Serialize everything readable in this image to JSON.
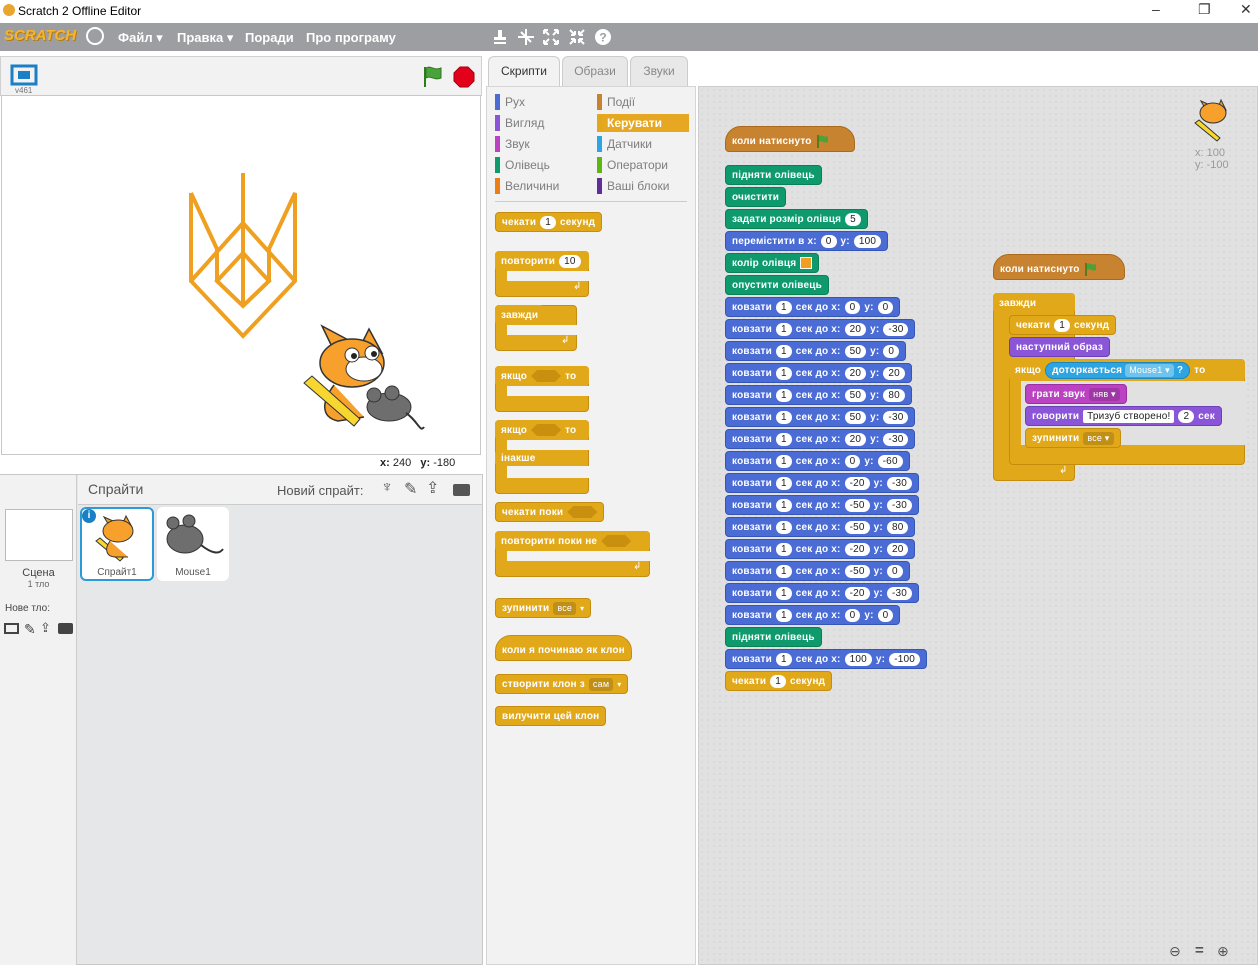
{
  "window": {
    "title": "Scratch 2 Offline Editor",
    "min": "–",
    "max": "❐",
    "close": "✕"
  },
  "menu": {
    "logo": "SCRATCH",
    "file": "Файл ▾",
    "edit": "Правка ▾",
    "tips": "Поради",
    "about": "Про програму"
  },
  "stage": {
    "version": "v461",
    "x_label": "x:",
    "x_val": "240",
    "y_label": "y:",
    "y_val": "-180"
  },
  "sprites": {
    "title": "Спрайти",
    "new_sprite": "Новий спрайт:",
    "scene": "Сцена",
    "scene_sub": "1 тло",
    "new_backdrop": "Нове тло:",
    "items": [
      {
        "name": "Спрайт1"
      },
      {
        "name": "Mouse1"
      }
    ]
  },
  "tabs": [
    "Скрипти",
    "Образи",
    "Звуки"
  ],
  "categories": {
    "left": [
      {
        "label": "Рух",
        "color": "#4a6cd4"
      },
      {
        "label": "Вигляд",
        "color": "#8a55d7"
      },
      {
        "label": "Звук",
        "color": "#bb42c3"
      },
      {
        "label": "Олівець",
        "color": "#0e9a6c"
      },
      {
        "label": "Величини",
        "color": "#ee7d16"
      }
    ],
    "right": [
      {
        "label": "Події",
        "color": "#c88330"
      },
      {
        "label": "Керувати",
        "color": "#e1a91a"
      },
      {
        "label": "Датчики",
        "color": "#2ca5e2"
      },
      {
        "label": "Оператори",
        "color": "#5cb712"
      },
      {
        "label": "Ваші блоки",
        "color": "#632d99"
      }
    ]
  },
  "palette": {
    "wait": "чекати",
    "wait_n": "1",
    "seconds": "секунд",
    "repeat": "повторити",
    "repeat_n": "10",
    "forever": "завжди",
    "if": "якщо",
    "then": "то",
    "else": "інакше",
    "wait_until": "чекати поки",
    "repeat_until": "повторити поки не",
    "stop": "зупинити",
    "stop_opt": "все",
    "clone_start": "коли я починаю як клон",
    "create_clone": "створити клон з",
    "clone_opt": "сам",
    "delete_clone": "вилучити цей клон"
  },
  "sprite_info": {
    "x": "x: 100",
    "y": "y: -100"
  },
  "script1": {
    "hat": "коли натиснуто",
    "pen_up": "підняти олівець",
    "clear": "очистити",
    "set_size": "задати розмір олівця",
    "size": "5",
    "goto": "перемістити в x:",
    "goto_x": "0",
    "y": "y:",
    "goto_y": "100",
    "pen_color": "колір олівця",
    "pen_down": "опустити олівець",
    "glide": "ковзати",
    "glide_mid": "сек до x:",
    "glides": [
      {
        "t": "1",
        "x": "0",
        "y": "0"
      },
      {
        "t": "1",
        "x": "20",
        "y": "-30"
      },
      {
        "t": "1",
        "x": "50",
        "y": "0"
      },
      {
        "t": "1",
        "x": "20",
        "y": "20"
      },
      {
        "t": "1",
        "x": "50",
        "y": "80"
      },
      {
        "t": "1",
        "x": "50",
        "y": "-30"
      },
      {
        "t": "1",
        "x": "20",
        "y": "-30"
      },
      {
        "t": "1",
        "x": "0",
        "y": "-60"
      },
      {
        "t": "1",
        "x": "-20",
        "y": "-30"
      },
      {
        "t": "1",
        "x": "-50",
        "y": "-30"
      },
      {
        "t": "1",
        "x": "-50",
        "y": "80"
      },
      {
        "t": "1",
        "x": "-20",
        "y": "20"
      },
      {
        "t": "1",
        "x": "-50",
        "y": "0"
      },
      {
        "t": "1",
        "x": "-20",
        "y": "-30"
      },
      {
        "t": "1",
        "x": "0",
        "y": "0"
      }
    ],
    "pen_up2": "підняти олівець",
    "last_glide": {
      "t": "1",
      "x": "100",
      "y": "-100"
    },
    "wait": "чекати",
    "wait_n": "1",
    "seconds": "секунд"
  },
  "script2": {
    "hat": "коли натиснуто",
    "forever": "завжди",
    "wait": "чекати",
    "wait_n": "1",
    "seconds": "секунд",
    "next_costume": "наступний образ",
    "if": "якщо",
    "touching": "доторкається",
    "touch_target": "Mouse1 ▾",
    "q": "?",
    "then": "то",
    "play_sound": "грати звук",
    "sound": "няв ▾",
    "say": "говорити",
    "say_text": "Тризуб створено!",
    "say_n": "2",
    "say_sec": "сек",
    "stop": "зупинити",
    "stop_opt": "все ▾"
  },
  "colors": {
    "trident": "#f0a020",
    "control": "#e1a91a",
    "motion": "#4a6cd4"
  }
}
